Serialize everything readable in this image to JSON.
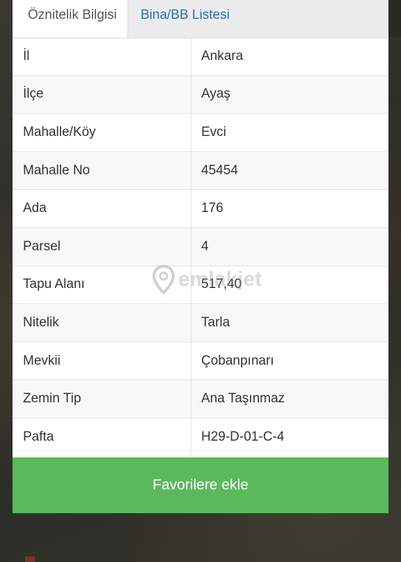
{
  "tabs": [
    {
      "label": "Öznitelik Bilgisi",
      "active": true
    },
    {
      "label": "Bina/BB Listesi",
      "active": false
    }
  ],
  "attributes": [
    {
      "key": "İl",
      "value": "Ankara"
    },
    {
      "key": "İlçe",
      "value": "Ayaş"
    },
    {
      "key": "Mahalle/Köy",
      "value": "Evci"
    },
    {
      "key": "Mahalle No",
      "value": "45454"
    },
    {
      "key": "Ada",
      "value": "176"
    },
    {
      "key": "Parsel",
      "value": "4"
    },
    {
      "key": "Tapu Alanı",
      "value": "517,40"
    },
    {
      "key": "Nitelik",
      "value": "Tarla"
    },
    {
      "key": "Mevkii",
      "value": "Çobanpınarı"
    },
    {
      "key": "Zemin Tip",
      "value": "Ana Taşınmaz"
    },
    {
      "key": "Pafta",
      "value": "H29-D-01-C-4"
    }
  ],
  "favorite_button": {
    "label": "Favorilere ekle",
    "color": "#5cb85c"
  },
  "watermark": {
    "text": "emlakjet",
    "icon": "location-pin-icon"
  },
  "colors": {
    "tab_link": "#2b6cb0",
    "tab_bar": "#ececec"
  }
}
